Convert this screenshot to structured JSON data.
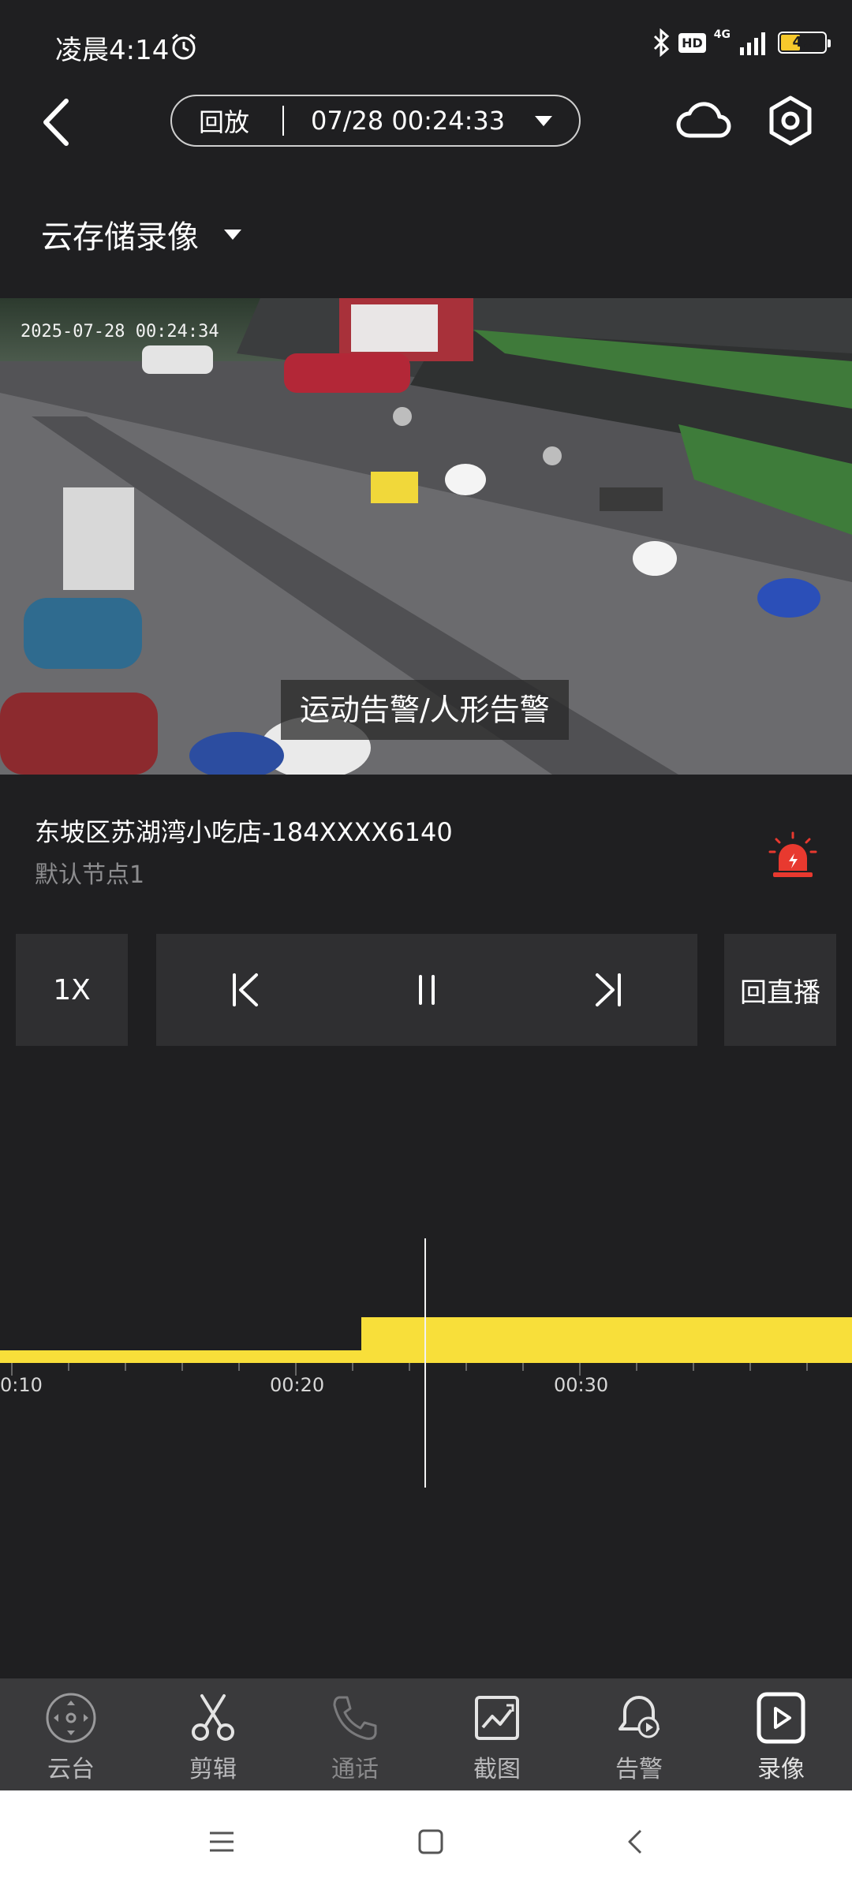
{
  "status_bar": {
    "time": "凌晨4:14",
    "hd": "HD",
    "network": "4G",
    "battery": "41"
  },
  "nav": {
    "mode": "回放",
    "datetime": "07/28 00:24:33",
    "storage_label": "云存储录像"
  },
  "video": {
    "timestamp": "2025-07-28 00:24:34",
    "alert_text": "运动告警/人形告警"
  },
  "device": {
    "name": "东坡区苏湖湾小吃店-184XXXX6140",
    "node": "默认节点1"
  },
  "controls": {
    "speed": "1X",
    "live": "回直播"
  },
  "timeline": {
    "labels": [
      "0:10",
      "00:20",
      "00:30"
    ],
    "bar_color": "#f8df3a"
  },
  "tabs": [
    {
      "label": "云台",
      "icon": "ptz-icon"
    },
    {
      "label": "剪辑",
      "icon": "scissors-icon"
    },
    {
      "label": "通话",
      "icon": "phone-icon"
    },
    {
      "label": "截图",
      "icon": "screenshot-icon"
    },
    {
      "label": "告警",
      "icon": "alarm-bell-icon"
    },
    {
      "label": "录像",
      "icon": "video-icon"
    }
  ],
  "colors": {
    "background": "#1f1f21",
    "accent_yellow": "#f8df3a",
    "alarm_red": "#e8392f"
  }
}
